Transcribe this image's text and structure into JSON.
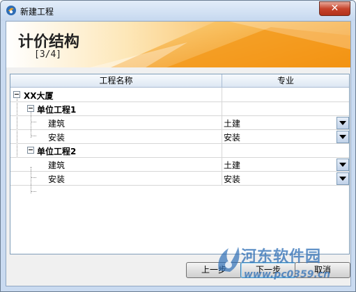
{
  "window": {
    "title": "新建工程",
    "close_label": "✕"
  },
  "banner": {
    "title": "计价结构",
    "step": "[3/4]"
  },
  "grid": {
    "headers": [
      "工程名称",
      "专业"
    ],
    "rows": [
      {
        "name": "XX大厦",
        "level": 0,
        "bold": true,
        "expandable": true,
        "specialty": ""
      },
      {
        "name": "单位工程1",
        "level": 1,
        "bold": true,
        "expandable": true,
        "specialty": ""
      },
      {
        "name": "建筑",
        "level": 2,
        "bold": false,
        "expandable": false,
        "specialty": "土建"
      },
      {
        "name": "安装",
        "level": 2,
        "bold": false,
        "expandable": false,
        "specialty": "安装"
      },
      {
        "name": "单位工程2",
        "level": 1,
        "bold": true,
        "expandable": true,
        "specialty": ""
      },
      {
        "name": "建筑",
        "level": 2,
        "bold": false,
        "expandable": false,
        "specialty": "土建"
      },
      {
        "name": "安装",
        "level": 2,
        "bold": false,
        "expandable": false,
        "specialty": "安装"
      }
    ]
  },
  "buttons": {
    "prev": "上一步",
    "next": "下一步",
    "cancel": "取消"
  },
  "watermark": {
    "text": "河东软件园",
    "url": "www.pc0359.cn"
  },
  "colors": {
    "banner_accent": "#f5a623",
    "title_bar": "#c6d8ef",
    "watermark": "#2f6fb6"
  }
}
